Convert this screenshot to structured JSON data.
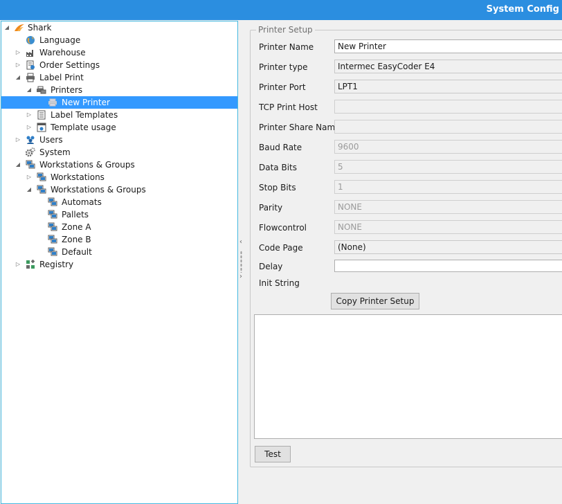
{
  "window": {
    "title": "System Config"
  },
  "tree": {
    "items": [
      {
        "label": "Shark",
        "icon": "shark-logo-icon",
        "arrow": "expanded"
      },
      {
        "label": "Language",
        "icon": "globe-icon",
        "arrow": "none"
      },
      {
        "label": "Warehouse",
        "icon": "factory-icon",
        "arrow": "collapsed"
      },
      {
        "label": "Order Settings",
        "icon": "order-settings-icon",
        "arrow": "collapsed"
      },
      {
        "label": "Label Print",
        "icon": "printer-icon",
        "arrow": "expanded"
      },
      {
        "label": "Printers",
        "icon": "printers-icon",
        "arrow": "expanded"
      },
      {
        "label": "New Printer",
        "icon": "printer-icon",
        "arrow": "none",
        "selected": true
      },
      {
        "label": "Label Templates",
        "icon": "document-icon",
        "arrow": "collapsed"
      },
      {
        "label": "Template usage",
        "icon": "window-gear-icon",
        "arrow": "collapsed"
      },
      {
        "label": "Users",
        "icon": "users-icon",
        "arrow": "collapsed"
      },
      {
        "label": "System",
        "icon": "gears-icon",
        "arrow": "none"
      },
      {
        "label": "Workstations & Groups",
        "icon": "workstations-icon",
        "arrow": "expanded"
      },
      {
        "label": "Workstations",
        "icon": "workstations-icon",
        "arrow": "collapsed"
      },
      {
        "label": "Workstations & Groups",
        "icon": "workstations-icon",
        "arrow": "expanded"
      },
      {
        "label": "Automats",
        "icon": "workstation-icon",
        "arrow": "none"
      },
      {
        "label": "Pallets",
        "icon": "workstation-icon",
        "arrow": "none"
      },
      {
        "label": "Zone A",
        "icon": "workstation-icon",
        "arrow": "none"
      },
      {
        "label": "Zone B",
        "icon": "workstation-icon",
        "arrow": "none"
      },
      {
        "label": "Default",
        "icon": "workstation-icon",
        "arrow": "none"
      },
      {
        "label": "Registry",
        "icon": "registry-icon",
        "arrow": "collapsed"
      }
    ]
  },
  "printer_setup": {
    "legend": "Printer Setup",
    "fields": [
      {
        "label": "Printer Name",
        "value": "New Printer",
        "state": "editable"
      },
      {
        "label": "Printer type",
        "value": "Intermec EasyCoder E4",
        "state": "readonly"
      },
      {
        "label": "Printer Port",
        "value": "LPT1",
        "state": "readonly"
      },
      {
        "label": "TCP Print Host",
        "value": "",
        "state": "disabled"
      },
      {
        "label": "Printer Share Name",
        "value": "",
        "state": "disabled"
      },
      {
        "label": "Baud Rate",
        "value": "9600",
        "state": "disabled"
      },
      {
        "label": "Data Bits",
        "value": "5",
        "state": "disabled"
      },
      {
        "label": "Stop Bits",
        "value": "1",
        "state": "disabled"
      },
      {
        "label": "Parity",
        "value": "NONE",
        "state": "disabled"
      },
      {
        "label": "Flowcontrol",
        "value": "NONE",
        "state": "disabled"
      },
      {
        "label": "Code Page",
        "value": "(None)",
        "state": "readonly"
      },
      {
        "label": "Delay",
        "value": "",
        "state": "editable"
      }
    ],
    "init_string_label": "Init String",
    "init_string_value": "",
    "copy_button": "Copy Printer Setup",
    "test_button": "Test"
  },
  "colors": {
    "titlebar": "#2b8ee0",
    "selection": "#3399ff",
    "tree_border": "#44b8e0"
  }
}
